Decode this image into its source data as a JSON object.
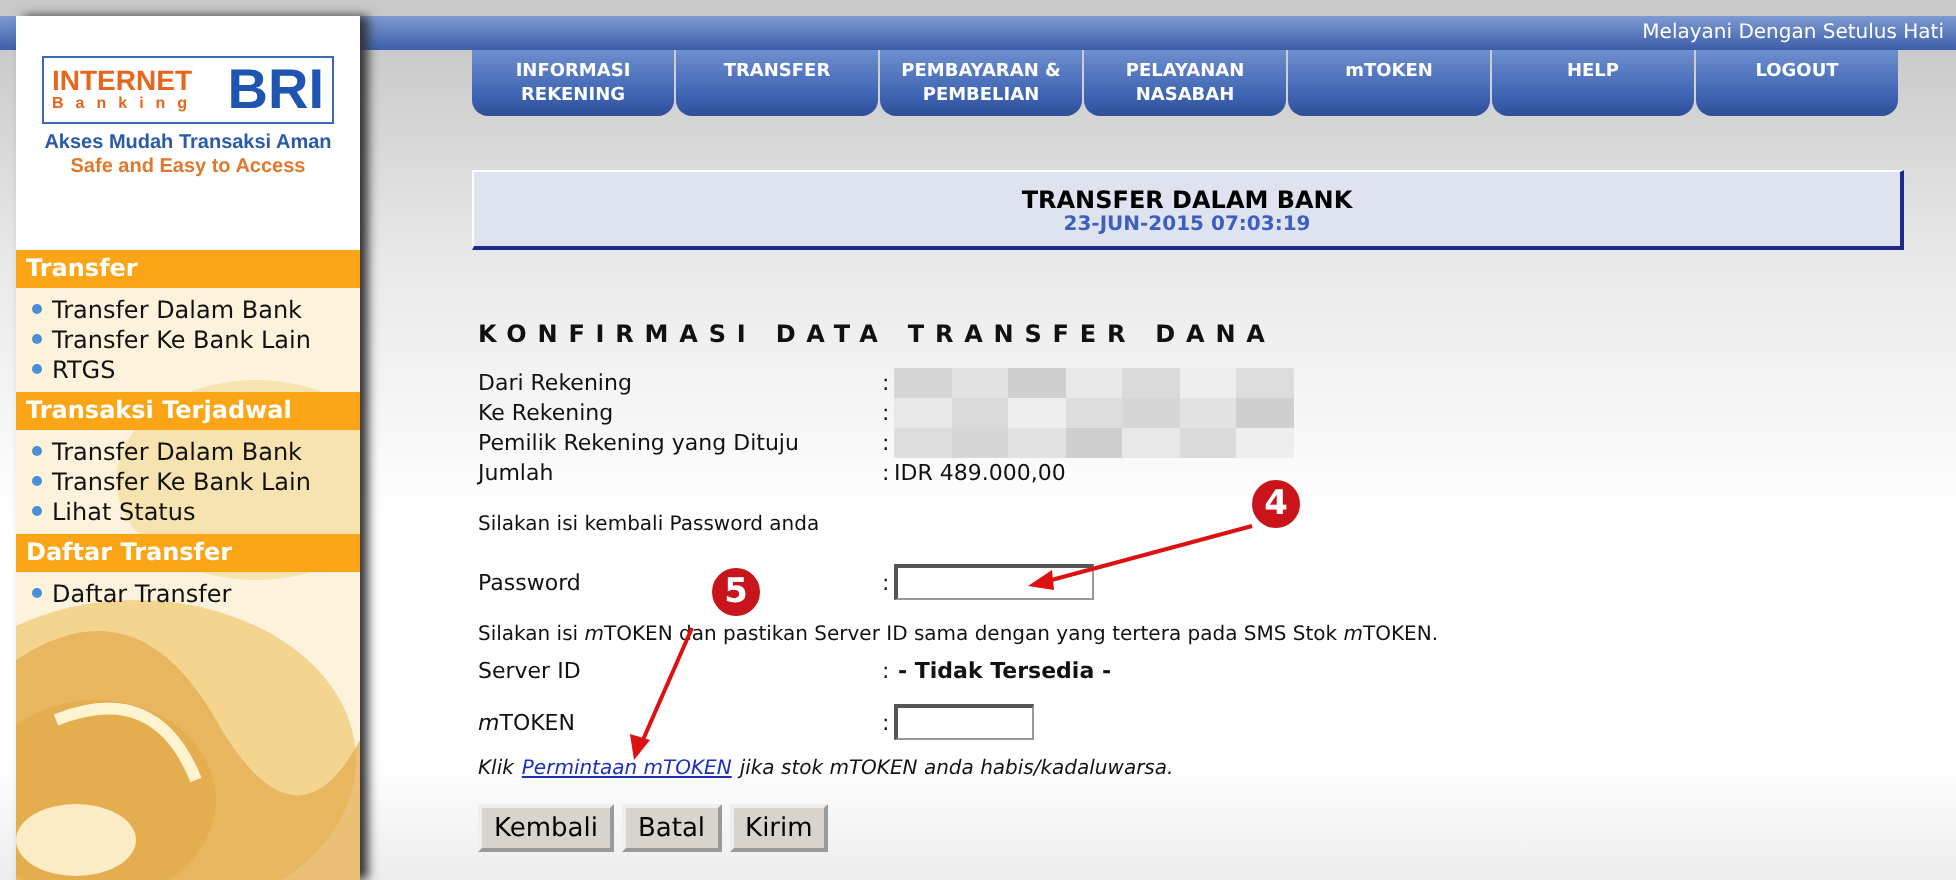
{
  "header": {
    "tagline": "Melayani Dengan Setulus Hati"
  },
  "logo": {
    "word_1": "INTERNET",
    "word_2": "Banking",
    "word_3": "BRI",
    "slogan": "Akses Mudah Transaksi Aman",
    "slogan_en": "Safe and Easy to Access"
  },
  "sidebar": {
    "sections": [
      {
        "title": "Transfer",
        "items": [
          "Transfer Dalam Bank",
          "Transfer Ke Bank Lain",
          "RTGS"
        ]
      },
      {
        "title": "Transaksi Terjadwal",
        "items": [
          "Transfer Dalam Bank",
          "Transfer Ke Bank Lain",
          "Lihat Status"
        ]
      },
      {
        "title": "Daftar Transfer",
        "items": [
          "Daftar Transfer"
        ]
      }
    ]
  },
  "nav_tabs": [
    {
      "line_1": "INFORMASI",
      "line_2": "REKENING"
    },
    {
      "line_1": "TRANSFER"
    },
    {
      "line_1": "PEMBAYARAN &",
      "line_2": "PEMBELIAN"
    },
    {
      "line_1": "PELAYANAN",
      "line_2": "NASABAH"
    },
    {
      "line_1": "mTOKEN"
    },
    {
      "line_1": "HELP"
    },
    {
      "line_1": "LOGOUT"
    }
  ],
  "title_box": {
    "title": "TRANSFER DALAM BANK",
    "datetime": "23-JUN-2015 07:03:19"
  },
  "heading": "KONFIRMASI DATA TRANSFER DANA",
  "details": [
    {
      "label": "Dari Rekening",
      "colon": ":",
      "kind": "redacted"
    },
    {
      "label": "Ke Rekening",
      "colon": ":",
      "kind": "redacted"
    },
    {
      "label": "Pemilik Rekening yang Dituju",
      "colon": ":",
      "kind": "redacted"
    },
    {
      "label": "Jumlah",
      "colon": ":",
      "kind": "text",
      "value": "IDR 489.000,00"
    }
  ],
  "password_prompt": "Silakan isi kembali Password anda",
  "password_label": {
    "label": "Password",
    "colon": ":"
  },
  "mtoken_prompt": [
    {
      "text": "Silakan isi ",
      "italic": false
    },
    {
      "text": "m",
      "italic": true
    },
    {
      "text": "TOKEN dan pastikan Server ID sama dengan yang tertera pada SMS Stok ",
      "italic": false
    },
    {
      "text": "m",
      "italic": true
    },
    {
      "text": "TOKEN.",
      "italic": false
    }
  ],
  "server_id": {
    "label": "Server ID",
    "colon": ":",
    "value": "- Tidak Tersedia -"
  },
  "mtoken_label": {
    "parts": [
      {
        "text": "m",
        "italic": true
      },
      {
        "text": "TOKEN",
        "italic": false
      }
    ],
    "colon": ":"
  },
  "note": {
    "before": "Klik",
    "link": "Permintaan mTOKEN",
    "after": "jika stok mTOKEN anda habis/kadaluwarsa."
  },
  "buttons": [
    "Kembali",
    "Batal",
    "Kirim"
  ],
  "annotations": [
    "4",
    "5"
  ]
}
